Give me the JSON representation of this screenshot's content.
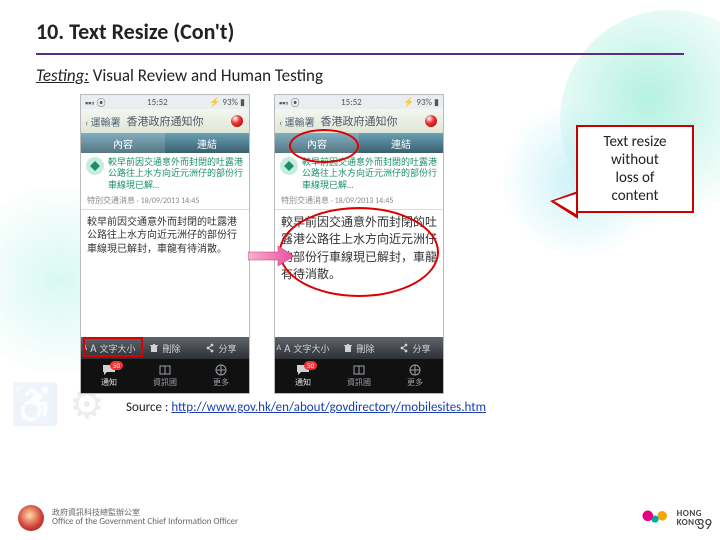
{
  "title": "10. Text Resize (Con't)",
  "subtitle_underlined": "Testing:",
  "subtitle_rest": " Visual Review and Human Testing",
  "callout_l1": "Text resize",
  "callout_l2": "without",
  "callout_l3": "loss of",
  "callout_l4": "content",
  "source_label": "Source : ",
  "source_url": "http://www.gov.hk/en/about/govdirectory/mobilesites.htm",
  "page_number": "39",
  "footer_office": "Office of the Government Chief Information Officer",
  "brand_l1": "HONG",
  "brand_l2": "KONG",
  "phone": {
    "time": "15:52",
    "battery": "93%",
    "nav_back": "‹ 運輸署",
    "nav_title": "香港政府通知你",
    "tab_active": "內容",
    "tab_other": "連結",
    "headline": "較早前因交通意外而封閉的吐露港公路往上水方向近元洲仔的部份行車線現已解…",
    "meta": "特別交通消息 · 18/09/2013 14:45",
    "body_small": "較早前因交通意外而封閉的吐露港公路往上水方向近元洲仔的部份行車線現已解封，車龍有待消散。",
    "body_large": "較早前因交通意外而封閉的吐露港公路往上水方向近元洲仔的部份行車線現已解封，車龍有待消散。",
    "tool_textsize": "文字大小",
    "tool_delete": "刪除",
    "tool_share": "分享",
    "nav_notify": "通知",
    "nav_info": "資訊國",
    "nav_more": "更多",
    "badge": "50"
  }
}
